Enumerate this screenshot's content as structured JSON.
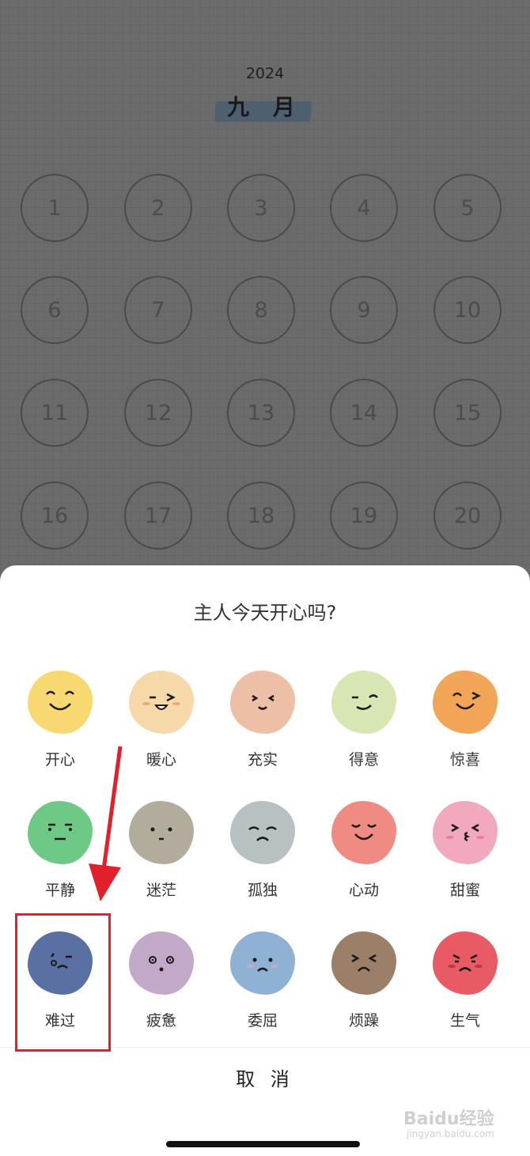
{
  "calendar": {
    "year": "2024",
    "month": "九 月",
    "days": [
      "1",
      "2",
      "3",
      "4",
      "5",
      "6",
      "7",
      "8",
      "9",
      "10",
      "11",
      "12",
      "13",
      "14",
      "15",
      "16",
      "17",
      "18",
      "19",
      "20"
    ]
  },
  "sheet": {
    "title": "主人今天开心吗?",
    "moods": [
      {
        "label": "开心",
        "color": "#f7d871",
        "icon": "happy-face-icon"
      },
      {
        "label": "暖心",
        "color": "#f7d9a9",
        "icon": "warm-face-icon"
      },
      {
        "label": "充实",
        "color": "#ecbfa6",
        "icon": "fulfilled-face-icon"
      },
      {
        "label": "得意",
        "color": "#d7e6b2",
        "icon": "smug-face-icon"
      },
      {
        "label": "惊喜",
        "color": "#f2a457",
        "icon": "surprised-face-icon"
      },
      {
        "label": "平静",
        "color": "#6ec986",
        "icon": "calm-face-icon"
      },
      {
        "label": "迷茫",
        "color": "#b1ac9b",
        "icon": "confused-face-icon"
      },
      {
        "label": "孤独",
        "color": "#b8c1c1",
        "icon": "lonely-face-icon"
      },
      {
        "label": "心动",
        "color": "#ef8b83",
        "icon": "heart-flutter-face-icon"
      },
      {
        "label": "甜蜜",
        "color": "#f2a8bd",
        "icon": "sweet-face-icon"
      },
      {
        "label": "难过",
        "color": "#5a6fa2",
        "icon": "sad-face-icon"
      },
      {
        "label": "疲惫",
        "color": "#c3a9c9",
        "icon": "tired-face-icon"
      },
      {
        "label": "委屈",
        "color": "#8fb1d3",
        "icon": "wronged-face-icon"
      },
      {
        "label": "烦躁",
        "color": "#9c7f68",
        "icon": "irritated-face-icon"
      },
      {
        "label": "生气",
        "color": "#e85b65",
        "icon": "angry-face-icon"
      }
    ],
    "cancel_label": "取 消"
  },
  "annotation": {
    "highlight_color": "#e0202b",
    "highlighted_mood": "难过"
  },
  "watermark": {
    "main": "Baidu经验",
    "sub": "jingyan.baidu.com"
  }
}
